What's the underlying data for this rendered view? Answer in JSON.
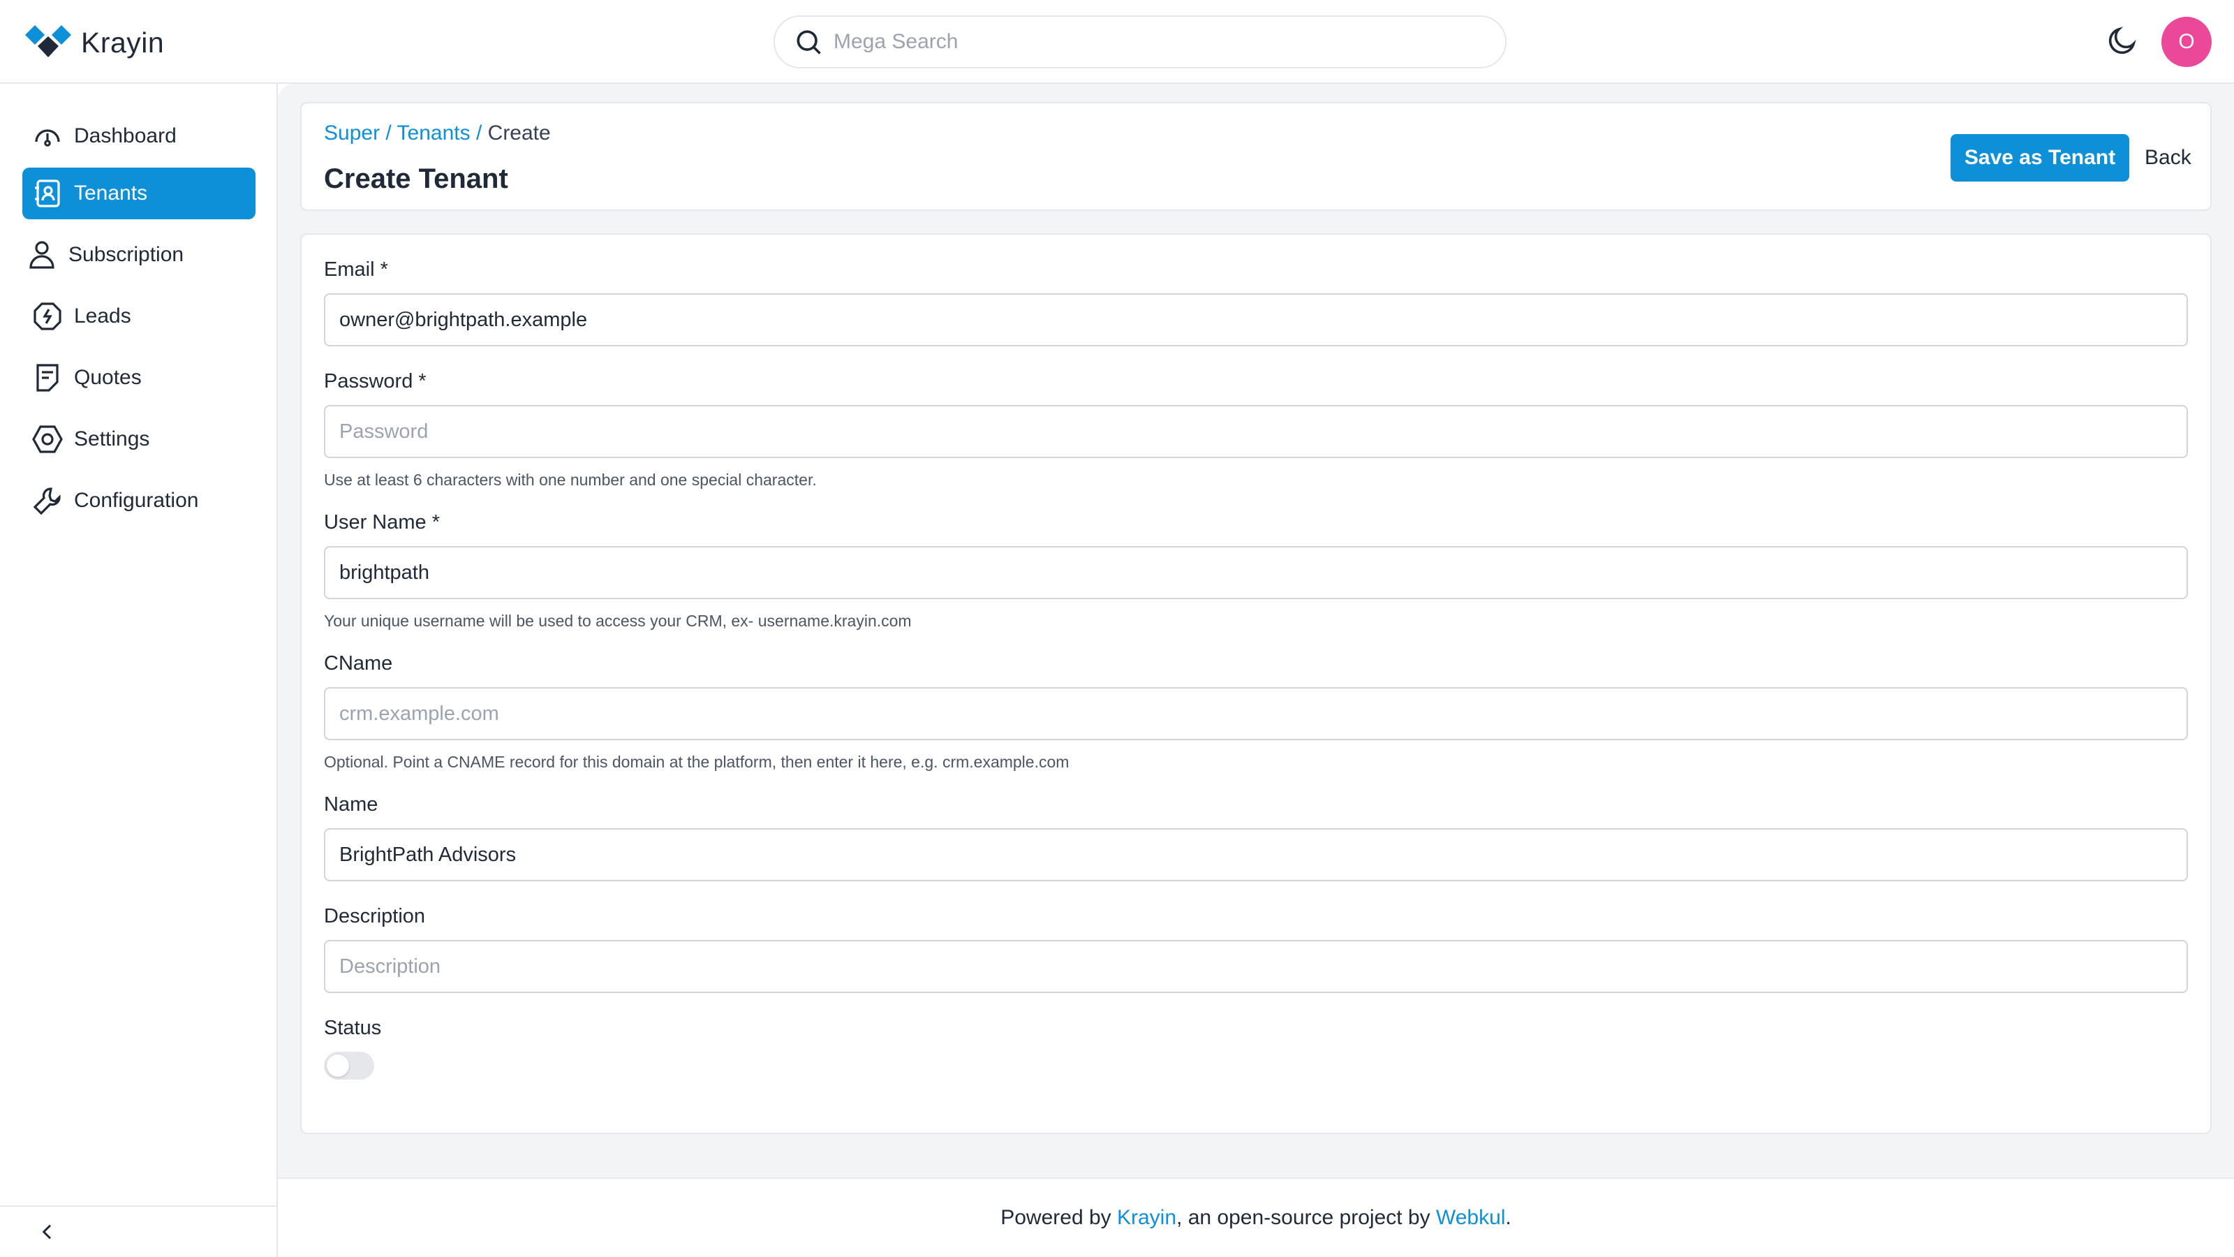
{
  "app": {
    "logo_text": "Krayin",
    "accent_color": "#0e90d9"
  },
  "header": {
    "search_placeholder": "Mega Search",
    "theme_toggle_icon": "moon-icon",
    "avatar_initial": "O",
    "avatar_color": "#ec4899"
  },
  "sidebar": {
    "items": [
      {
        "label": "Dashboard",
        "icon": "dashboard-icon",
        "active": false
      },
      {
        "label": "Tenants",
        "icon": "tenants-icon",
        "active": true
      },
      {
        "label": "Subscription",
        "icon": "user-icon",
        "active": false
      },
      {
        "label": "Leads",
        "icon": "leads-icon",
        "active": false
      },
      {
        "label": "Quotes",
        "icon": "quotes-icon",
        "active": false
      },
      {
        "label": "Settings",
        "icon": "settings-icon",
        "active": false
      },
      {
        "label": "Configuration",
        "icon": "wrench-icon",
        "active": false
      }
    ],
    "collapse_icon": "chevron-left-icon"
  },
  "page": {
    "breadcrumb": {
      "items": [
        "Super",
        "Tenants",
        "Create"
      ],
      "separator": "/"
    },
    "title": "Create Tenant",
    "save_label": "Save as Tenant",
    "back_label": "Back"
  },
  "form": {
    "email": {
      "label": "Email *",
      "value": "owner@brightpath.example"
    },
    "password": {
      "label": "Password *",
      "placeholder": "Password",
      "hint": "Use at least 6 characters with one number and one special character."
    },
    "username": {
      "label": "User Name *",
      "value": "brightpath",
      "hint": "Your unique username will be used to access your CRM, ex- username.krayin.com"
    },
    "cname": {
      "label": "CName",
      "placeholder": "crm.example.com",
      "hint": "Optional. Point a CNAME record for this domain at the platform, then enter it here, e.g. crm.example.com"
    },
    "name": {
      "label": "Name",
      "value": "BrightPath Advisors"
    },
    "description": {
      "label": "Description",
      "placeholder": "Description"
    },
    "status": {
      "label": "Status",
      "enabled": false
    }
  },
  "footer": {
    "prefix": "Powered by ",
    "krayin_link": "Krayin",
    "middle": ", an open-source project by ",
    "webkul_link": "Webkul",
    "suffix": "."
  }
}
